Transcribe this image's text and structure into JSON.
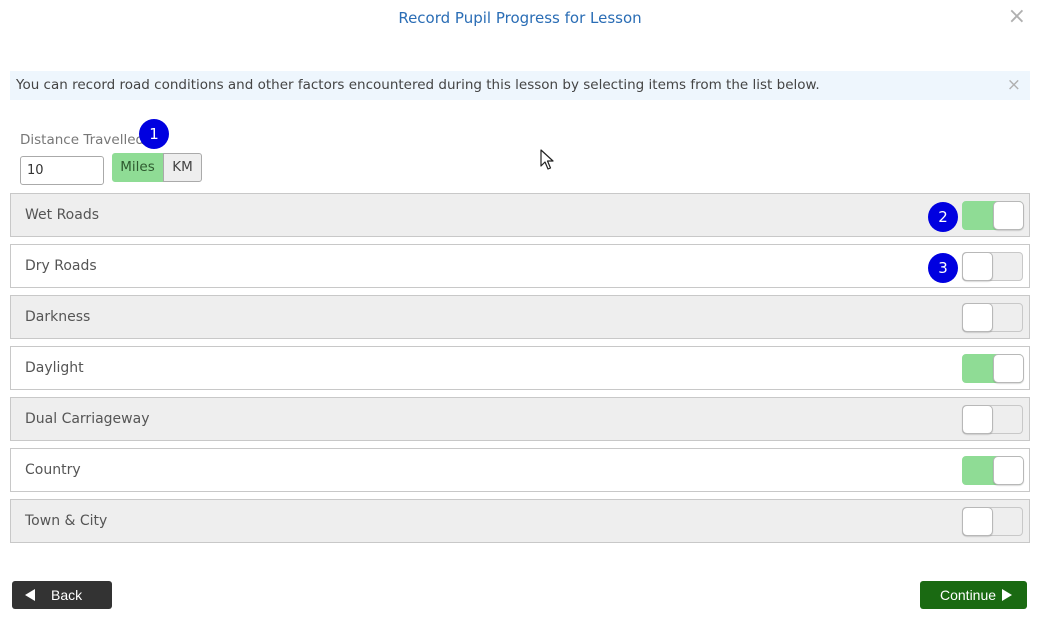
{
  "header": {
    "title": "Record Pupil Progress for Lesson",
    "close_icon": "×"
  },
  "info_banner": {
    "text": "You can record road conditions and other factors encountered during this lesson by selecting items from the list below.",
    "close_icon": "×"
  },
  "distance": {
    "label": "Distance Travelled",
    "value": "10",
    "units": [
      {
        "label": "Miles",
        "selected": true
      },
      {
        "label": "KM",
        "selected": false
      }
    ]
  },
  "badges": [
    "1",
    "2",
    "3"
  ],
  "conditions": [
    {
      "label": "Wet Roads",
      "on": true
    },
    {
      "label": "Dry Roads",
      "on": false
    },
    {
      "label": "Darkness",
      "on": false
    },
    {
      "label": "Daylight",
      "on": true
    },
    {
      "label": "Dual Carriageway",
      "on": false
    },
    {
      "label": "Country",
      "on": true
    },
    {
      "label": "Town & City",
      "on": false
    }
  ],
  "footer": {
    "back_label": "Back",
    "continue_label": "Continue"
  },
  "colors": {
    "toggle_on": "#8fdc95",
    "badge": "#0000e0",
    "continue_button": "#1a6a12",
    "back_button": "#333333",
    "title": "#2a6db5"
  }
}
